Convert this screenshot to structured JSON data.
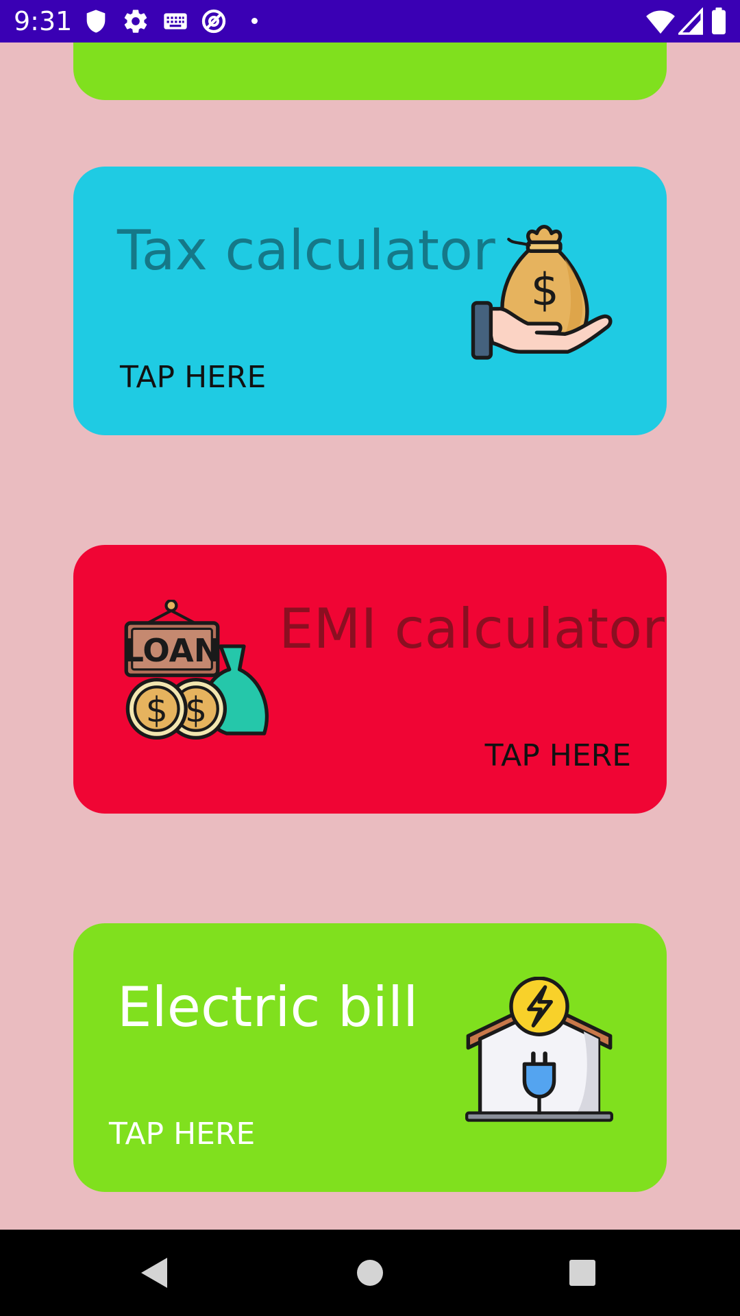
{
  "status_bar": {
    "time": "9:31",
    "left_icons": [
      "shield-icon",
      "gear-icon",
      "keyboard-icon",
      "at-sign-icon",
      "dot-icon"
    ],
    "right_icons": [
      "wifi-icon",
      "cell-signal-icon",
      "battery-icon"
    ]
  },
  "cards": {
    "tax": {
      "title": "Tax calculator",
      "tap_label": "TAP HERE",
      "color": "#1fcbe3",
      "icon": "money-bag-hand-icon"
    },
    "emi": {
      "title": "EMI calculator",
      "tap_label": "TAP HERE",
      "color": "#f00534",
      "icon": "loan-coins-icon"
    },
    "electric": {
      "title": "Electric bill",
      "tap_label": "TAP HERE",
      "color": "#80e01e",
      "icon": "house-electricity-icon"
    }
  },
  "colors": {
    "background": "#eabcc0",
    "status_bar": "#3a00b4",
    "nav_bar": "#000000"
  },
  "nav_bar": {
    "buttons": [
      "back-icon",
      "home-icon",
      "recents-icon"
    ]
  }
}
